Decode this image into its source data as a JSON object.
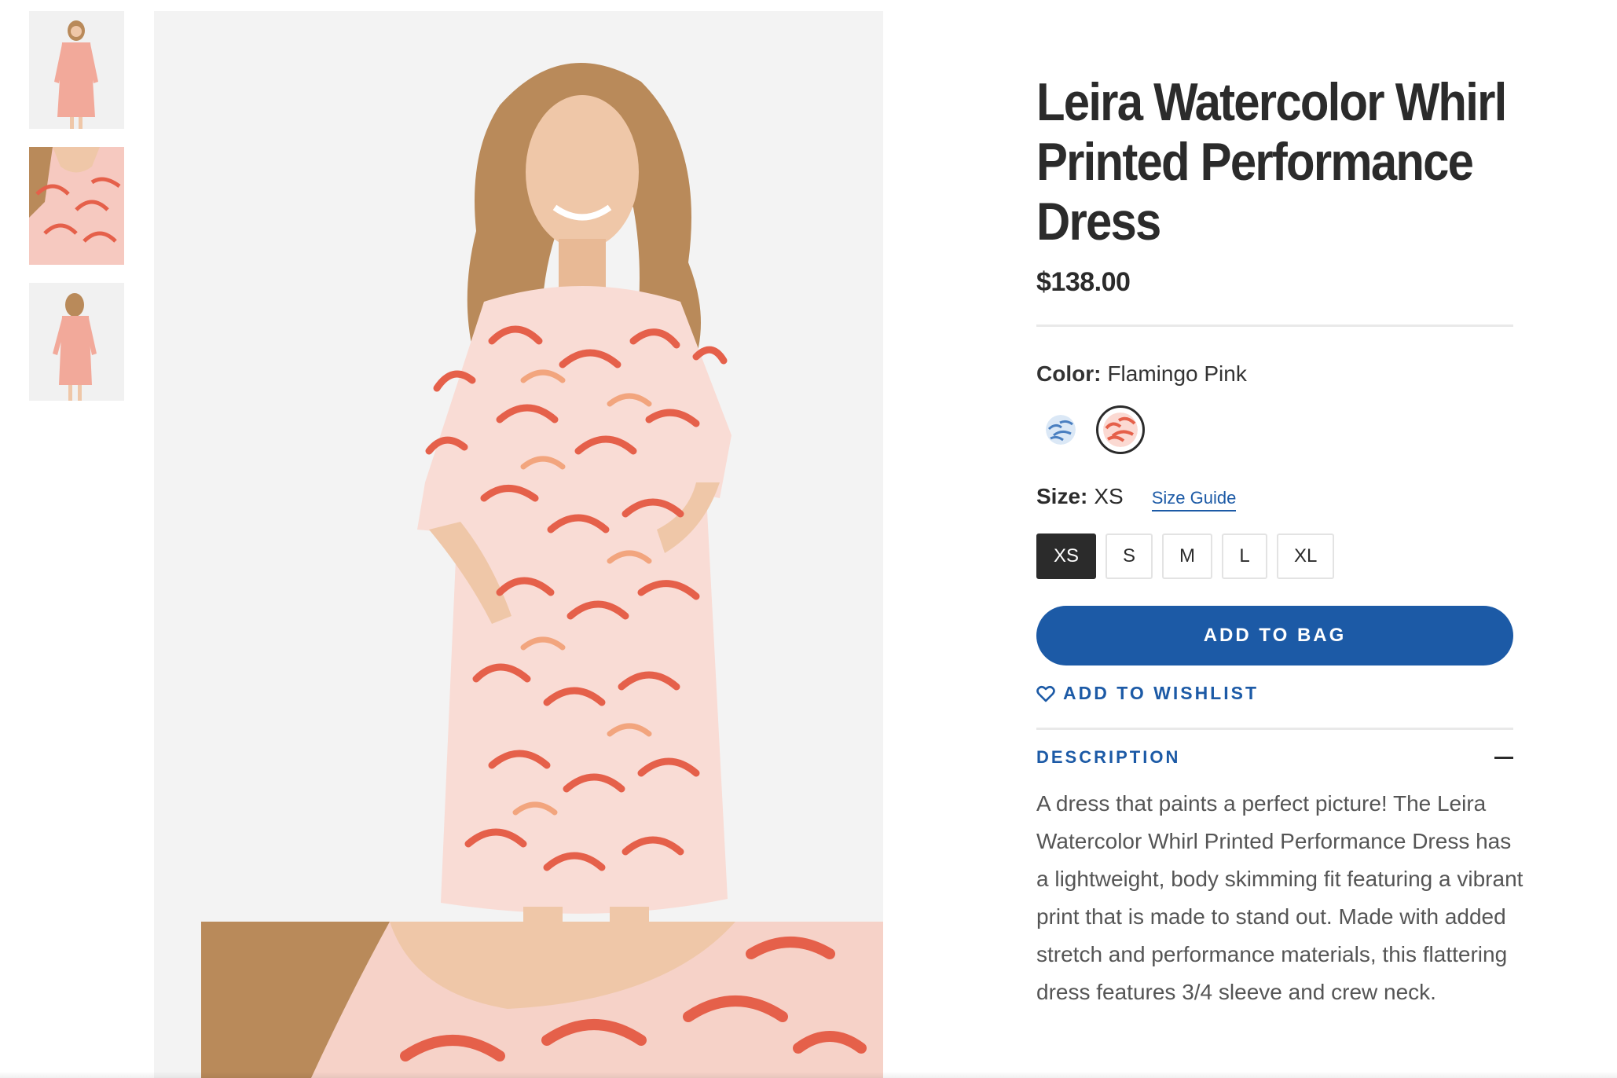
{
  "product": {
    "title": "Leira Watercolor Whirl Printed Performance Dress",
    "price": "$138.00"
  },
  "color": {
    "label": "Color:",
    "selected": "Flamingo Pink",
    "swatches": [
      {
        "name": "blue-swatch",
        "hex": "#7fa6d6"
      },
      {
        "name": "flamingo-pink-swatch",
        "hex": "#e5604a"
      }
    ]
  },
  "size": {
    "label": "Size:",
    "selected": "XS",
    "guide_label": "Size Guide",
    "options": [
      "XS",
      "S",
      "M",
      "L",
      "XL"
    ]
  },
  "actions": {
    "add_to_bag": "ADD TO BAG",
    "add_to_wishlist": "ADD TO WISHLIST"
  },
  "description": {
    "heading": "DESCRIPTION",
    "text": "A dress that paints a perfect picture! The Leira Watercolor Whirl Printed Performance Dress has a lightweight, body skimming fit featuring a vibrant print that is made to stand out. Made with added stretch and performance materials, this flattering dress features 3/4 sleeve and crew neck."
  },
  "colors": {
    "accent": "#1c5aa6",
    "dark": "#2b2b2b",
    "print": "#e5604a"
  },
  "icons": {
    "wishlist": "heart-icon",
    "collapse": "minus-icon"
  }
}
